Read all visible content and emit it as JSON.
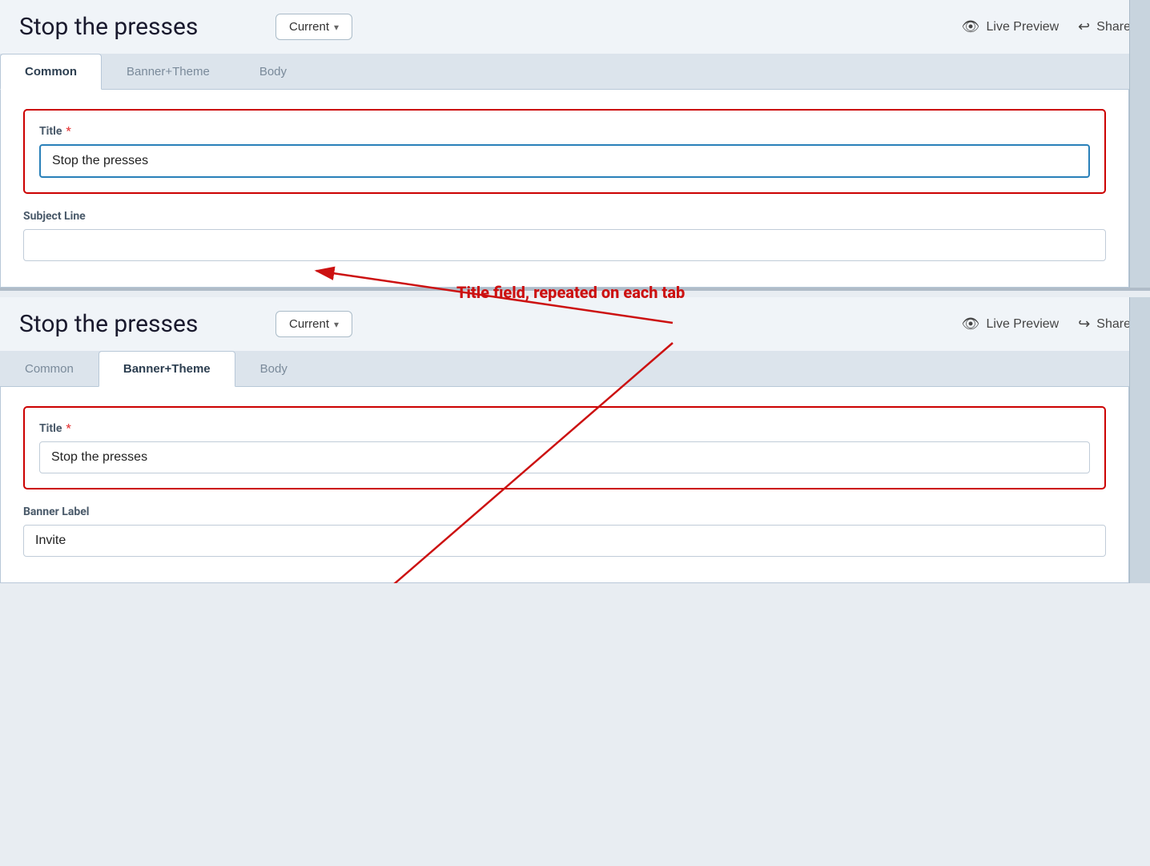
{
  "page": {
    "title": "Stop the presses",
    "version_label": "Current",
    "version_chevron": "▾",
    "live_preview_label": "Live Preview",
    "share_label": "Share"
  },
  "top_panel": {
    "tabs": [
      {
        "id": "common",
        "label": "Common",
        "active": true
      },
      {
        "id": "banner_theme",
        "label": "Banner+Theme",
        "active": false
      },
      {
        "id": "body",
        "label": "Body",
        "active": false
      }
    ],
    "title_field": {
      "label": "Title",
      "required": true,
      "value": "Stop the presses",
      "focused": true
    },
    "subject_line_field": {
      "label": "Subject Line",
      "value": "",
      "placeholder": ""
    }
  },
  "bottom_panel": {
    "tabs": [
      {
        "id": "common",
        "label": "Common",
        "active": false
      },
      {
        "id": "banner_theme",
        "label": "Banner+Theme",
        "active": true
      },
      {
        "id": "body",
        "label": "Body",
        "active": false
      }
    ],
    "title_field": {
      "label": "Title",
      "required": true,
      "value": "Stop the presses"
    },
    "banner_label_field": {
      "label": "Banner Label",
      "value": "Invite"
    }
  },
  "annotation": {
    "text": "Title field, repeated on each tab"
  },
  "icons": {
    "eye": "👁",
    "share": "↪",
    "chevron_down": "∨"
  }
}
